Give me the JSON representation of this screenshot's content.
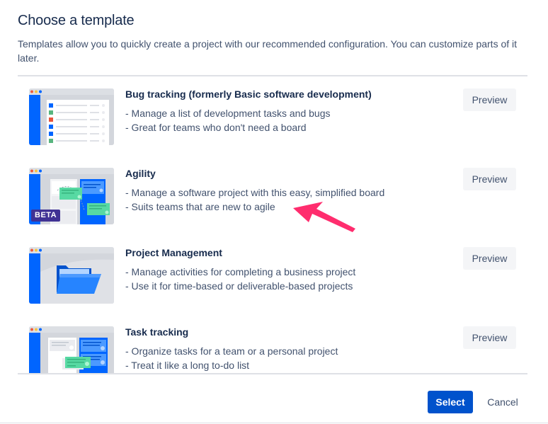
{
  "header": {
    "title": "Choose a template",
    "description": "Templates allow you to quickly create a project with our recommended configuration. You can customize parts of it later."
  },
  "templates": [
    {
      "title": "Bug tracking (formerly Basic software development)",
      "bullets": [
        "- Manage a list of development tasks and bugs",
        "- Great for teams who don't need a board"
      ],
      "preview_label": "Preview",
      "thumbnail": "bug-list-illustration"
    },
    {
      "title": "Agility",
      "bullets": [
        "- Manage a software project with this easy, simplified board",
        "- Suits teams that are new to agile"
      ],
      "preview_label": "Preview",
      "badge": "BETA",
      "thumbnail": "board-illustration"
    },
    {
      "title": "Project Management",
      "bullets": [
        "- Manage activities for completing a business project",
        "- Use it for time-based or deliverable-based projects"
      ],
      "preview_label": "Preview",
      "thumbnail": "folder-illustration"
    },
    {
      "title": "Task tracking",
      "bullets": [
        "- Organize tasks for a team or a personal project",
        "- Treat it like a long to-do list"
      ],
      "preview_label": "Preview",
      "thumbnail": "task-board-illustration"
    }
  ],
  "footer": {
    "select_label": "Select",
    "cancel_label": "Cancel"
  },
  "annotation": {
    "icon": "pointer-arrow-icon",
    "color": "#ff2d6e"
  },
  "colors": {
    "primary": "#0052cc",
    "heading": "#172b4d",
    "body": "#42526e",
    "beta_badge": "#403294"
  }
}
